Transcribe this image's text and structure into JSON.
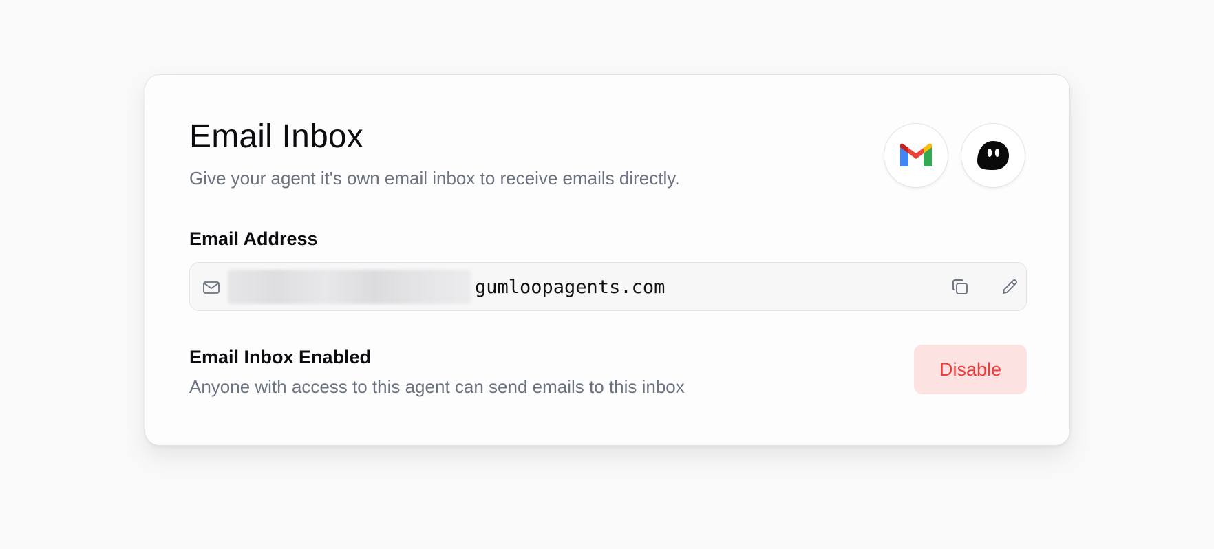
{
  "inbox": {
    "title": "Email Inbox",
    "subtitle": "Give your agent it's own email inbox to receive emails directly.",
    "logos": [
      "gmail-icon",
      "agent-logo-icon"
    ]
  },
  "email_field": {
    "label": "Email Address",
    "domain": "gumloopagents.com",
    "icons": [
      "mail-icon",
      "copy-icon",
      "pencil-icon"
    ]
  },
  "status": {
    "title": "Email Inbox Enabled",
    "description": "Anyone with access to this agent can send emails to this inbox",
    "disable_label": "Disable"
  },
  "colors": {
    "disable_bg": "#fde2e2",
    "disable_text": "#ef3b3b",
    "muted_text": "#6b7280"
  }
}
